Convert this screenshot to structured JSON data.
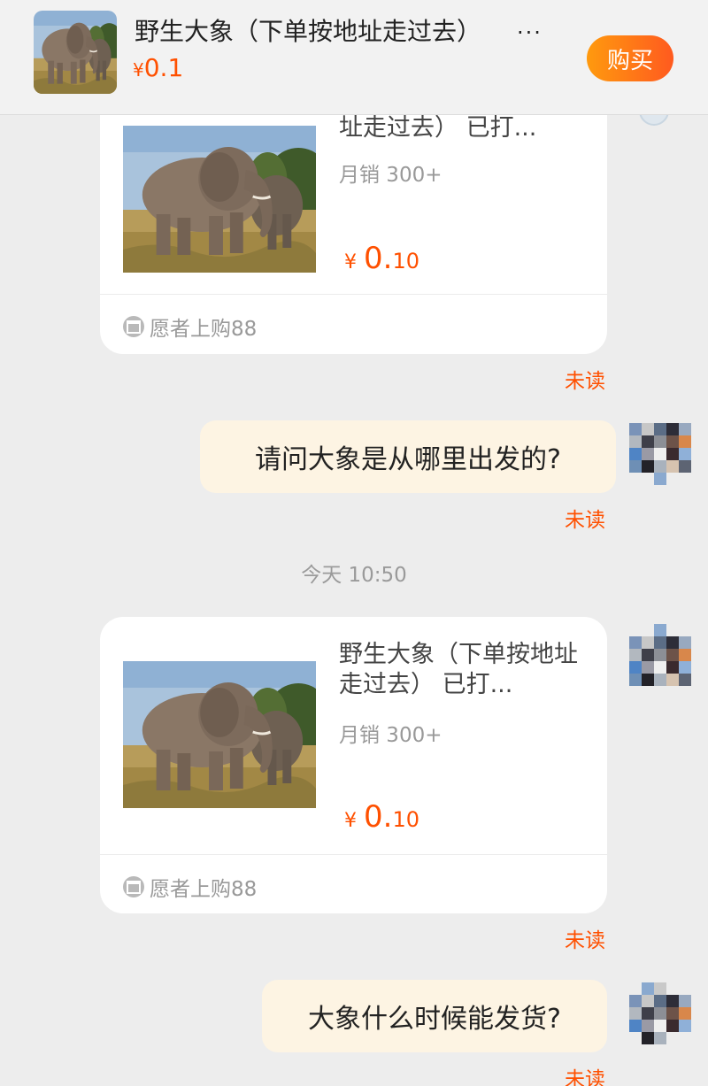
{
  "colors": {
    "accent": "#ff5000",
    "bubble": "#fdf4e3",
    "background": "#ededed"
  },
  "product": {
    "title": "野生大象（下单按地址走过去）",
    "more": "...",
    "price_currency": "¥",
    "price": "0.1",
    "buy_label": "购买",
    "image_icon": "elephant-photo"
  },
  "cards": [
    {
      "title": "址走过去）   已打...",
      "sales": "月销 300+",
      "price_currency": "¥",
      "price_int": "0.",
      "price_dec": "10",
      "shop": "愿者上购88",
      "status": "未读"
    },
    {
      "title": "野生大象（下单按地址走过去）   已打...",
      "sales": "月销 300+",
      "price_currency": "¥",
      "price_int": "0.",
      "price_dec": "10",
      "shop": "愿者上购88",
      "status": "未读"
    }
  ],
  "messages": [
    {
      "text": "请问大象是从哪里出发的?",
      "status": "未读"
    },
    {
      "text": "大象什么时候能发货?",
      "status": "未读"
    }
  ],
  "timestamp": "今天 10:50"
}
